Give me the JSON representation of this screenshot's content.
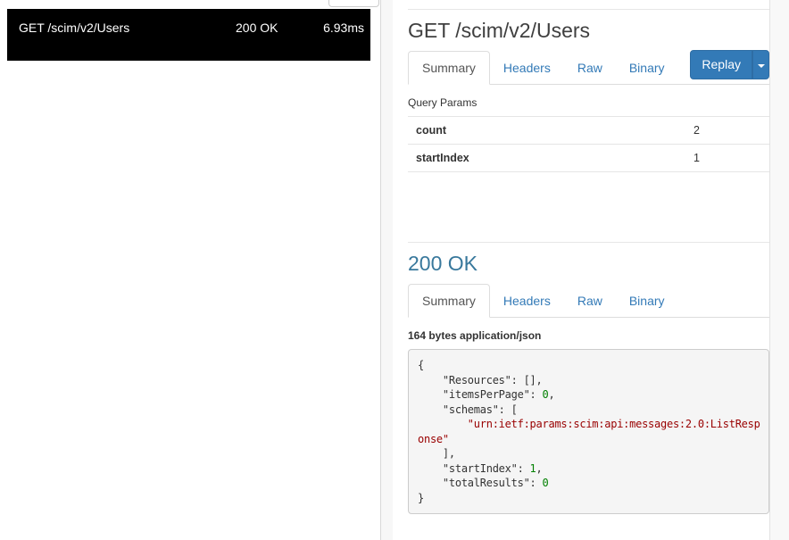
{
  "left_panel": {
    "selected_request": {
      "method_path": "GET /scim/v2/Users",
      "status_code": "200",
      "status_text": "OK",
      "duration": "6.93ms"
    }
  },
  "request_section": {
    "title": "GET /scim/v2/Users",
    "tabs": [
      {
        "label": "Summary",
        "active": true
      },
      {
        "label": "Headers",
        "active": false
      },
      {
        "label": "Raw",
        "active": false
      },
      {
        "label": "Binary",
        "active": false
      }
    ],
    "replay_button": "Replay",
    "query_params_heading": "Query Params",
    "query_params": [
      {
        "name": "count",
        "value": "2"
      },
      {
        "name": "startIndex",
        "value": "1"
      }
    ]
  },
  "response_section": {
    "title": "200 OK",
    "tabs": [
      {
        "label": "Summary",
        "active": true
      },
      {
        "label": "Headers",
        "active": false
      },
      {
        "label": "Raw",
        "active": false
      },
      {
        "label": "Binary",
        "active": false
      }
    ],
    "body_meta": "164 bytes application/json",
    "body_lines": [
      [
        {
          "t": "{",
          "c": "pln"
        }
      ],
      [
        {
          "t": "    \"Resources\": [],",
          "c": "pln"
        }
      ],
      [
        {
          "t": "    \"itemsPerPage\": ",
          "c": "pln"
        },
        {
          "t": "0",
          "c": "num"
        },
        {
          "t": ",",
          "c": "pln"
        }
      ],
      [
        {
          "t": "    \"schemas\": [",
          "c": "pln"
        }
      ],
      [
        {
          "t": "        ",
          "c": "pln"
        },
        {
          "t": "\"urn:ietf:params:scim:api:messages:2.0:ListResp",
          "c": "str"
        }
      ],
      [
        {
          "t": "onse\"",
          "c": "str"
        }
      ],
      [
        {
          "t": "    ],",
          "c": "pln"
        }
      ],
      [
        {
          "t": "    \"startIndex\": ",
          "c": "pln"
        },
        {
          "t": "1",
          "c": "num"
        },
        {
          "t": ",",
          "c": "pln"
        }
      ],
      [
        {
          "t": "    \"totalResults\": ",
          "c": "pln"
        },
        {
          "t": "0",
          "c": "num"
        }
      ],
      [
        {
          "t": "}",
          "c": "pln"
        }
      ]
    ]
  },
  "colors": {
    "accent_blue": "#337ab7",
    "status_heading": "#38789c",
    "selected_row_bg": "#000000",
    "code_string": "#990000",
    "code_number": "#008000"
  }
}
